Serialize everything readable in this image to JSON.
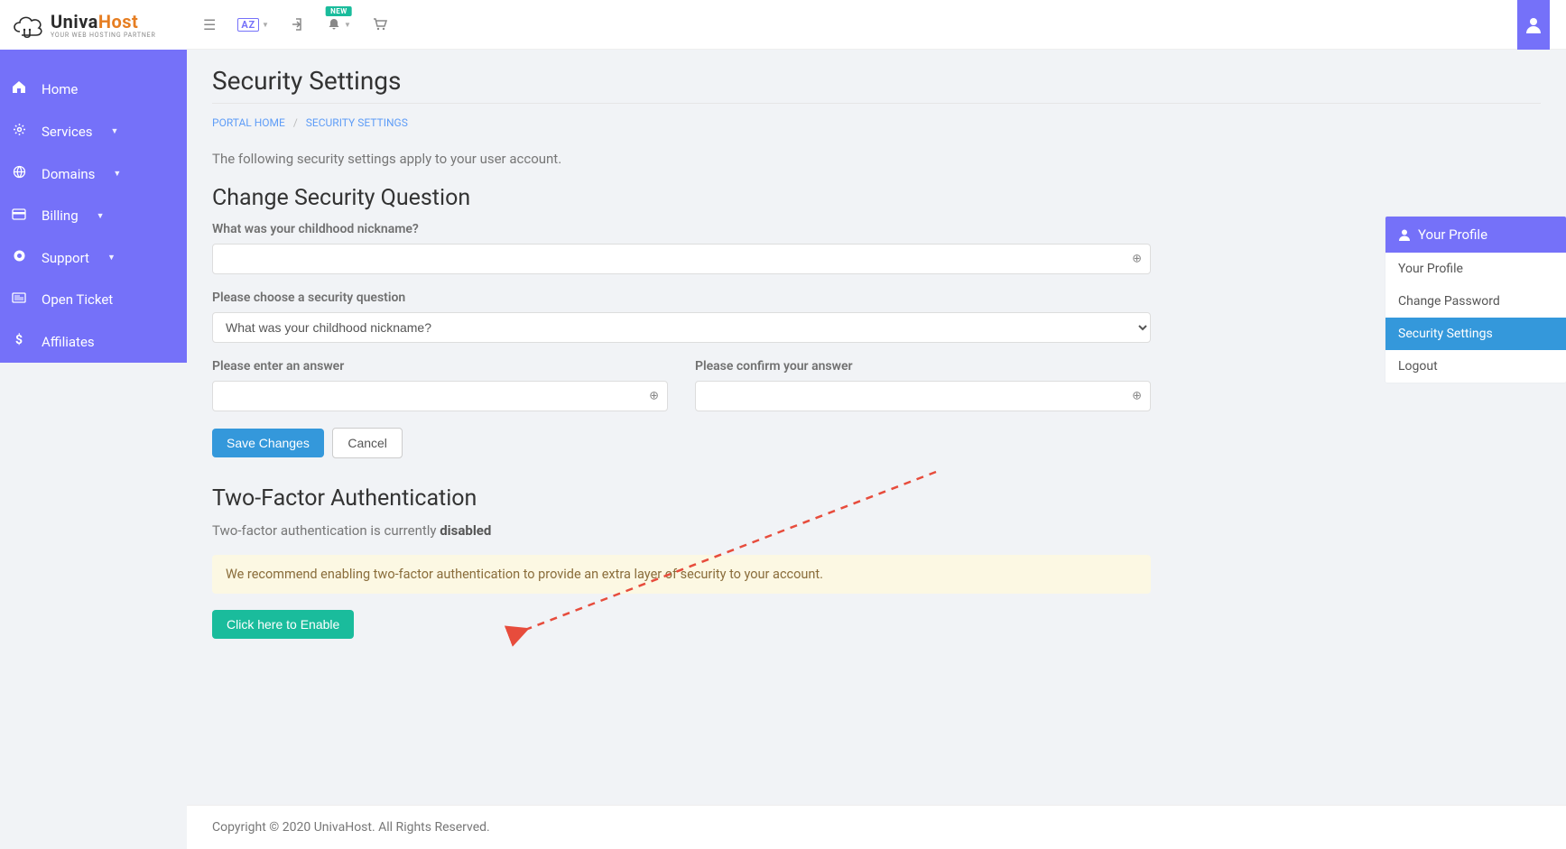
{
  "logo": {
    "brand_main": "Univa",
    "brand_accent": "Host",
    "tagline": "YOUR WEB HOSTING PARTNER"
  },
  "top": {
    "new_badge": "NEW",
    "lang_label": "AZ"
  },
  "sidebar": {
    "items": [
      {
        "label": "Home",
        "icon": "home",
        "chev": false
      },
      {
        "label": "Services",
        "icon": "gear",
        "chev": true
      },
      {
        "label": "Domains",
        "icon": "globe",
        "chev": true
      },
      {
        "label": "Billing",
        "icon": "card",
        "chev": true
      },
      {
        "label": "Support",
        "icon": "life",
        "chev": true
      },
      {
        "label": "Open Ticket",
        "icon": "ticket",
        "chev": false
      },
      {
        "label": "Affiliates",
        "icon": "dollar",
        "chev": false
      }
    ]
  },
  "page": {
    "title": "Security Settings",
    "breadcrumb_home": "PORTAL HOME",
    "breadcrumb_current": "SECURITY SETTINGS",
    "intro": "The following security settings apply to your user account."
  },
  "sec_q": {
    "heading": "Change Security Question",
    "label_current": "What was your childhood nickname?",
    "label_choose": "Please choose a security question",
    "select_value": "What was your childhood nickname?",
    "label_answer": "Please enter an answer",
    "label_confirm": "Please confirm your answer",
    "btn_save": "Save Changes",
    "btn_cancel": "Cancel"
  },
  "tfa": {
    "heading": "Two-Factor Authentication",
    "status_prefix": "Two-factor authentication is currently ",
    "status_value": "disabled",
    "recommend": "We recommend enabling two-factor authentication to provide an extra layer of security to your account.",
    "btn_enable": "Click here to Enable"
  },
  "profile": {
    "head": "Your Profile",
    "items": [
      "Your Profile",
      "Change Password",
      "Security Settings",
      "Logout"
    ],
    "active_index": 2
  },
  "footer": {
    "text": "Copyright © 2020 UnivaHost. All Rights Reserved."
  }
}
